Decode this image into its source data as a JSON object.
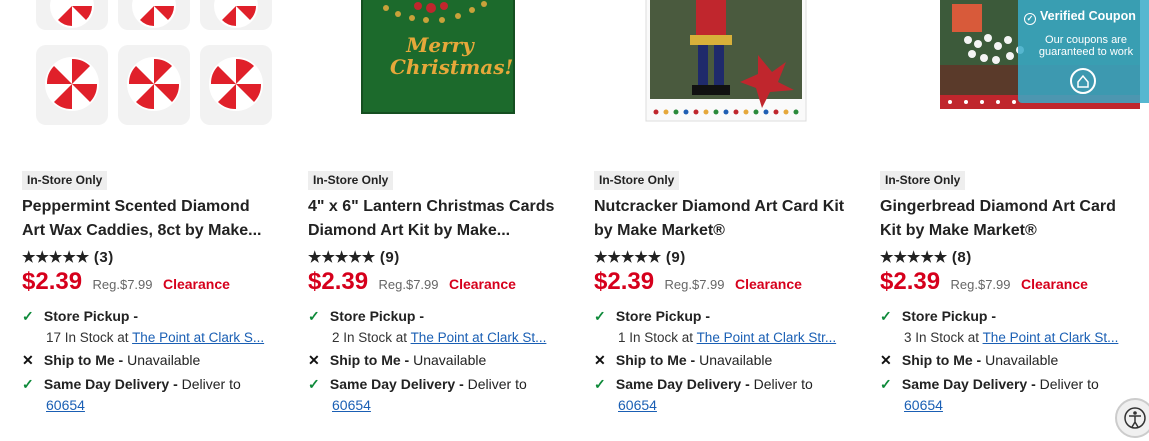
{
  "products": [
    {
      "badge": "In-Store Only",
      "title_line1": "Peppermint Scented Diamond",
      "title_line2": "Art Wax Caddies, 8ct by Make...",
      "stars": "★★★★★",
      "reviews": "(3)",
      "price": "$2.39",
      "reg": "Reg.$7.99",
      "clearance": "Clearance",
      "store_pickup": "Store Pickup -",
      "stock_text": "17 In Stock at ",
      "store_link": "The Point at Clark S...",
      "ship_label": "Ship to Me -",
      "ship_status": "Unavailable",
      "sdd_label": "Same Day Delivery -",
      "sdd_text": "Deliver to",
      "zip": "60654"
    },
    {
      "badge": "In-Store Only",
      "title_line1": "4\" x 6\" Lantern Christmas Cards",
      "title_line2": "Diamond Art Kit by Make...",
      "stars": "★★★★★",
      "reviews": "(9)",
      "price": "$2.39",
      "reg": "Reg.$7.99",
      "clearance": "Clearance",
      "store_pickup": "Store Pickup -",
      "stock_text": "2 In Stock at ",
      "store_link": "The Point at Clark St...",
      "ship_label": "Ship to Me -",
      "ship_status": "Unavailable",
      "sdd_label": "Same Day Delivery -",
      "sdd_text": "Deliver to",
      "zip": "60654",
      "card_text_1": "Merry",
      "card_text_2": "Christmas!"
    },
    {
      "badge": "In-Store Only",
      "title_line1": "Nutcracker Diamond Art Card Kit",
      "title_line2": "by Make Market®",
      "stars": "★★★★★",
      "reviews": "(9)",
      "price": "$2.39",
      "reg": "Reg.$7.99",
      "clearance": "Clearance",
      "store_pickup": "Store Pickup -",
      "stock_text": "1 In Stock at ",
      "store_link": "The Point at Clark Str...",
      "ship_label": "Ship to Me -",
      "ship_status": "Unavailable",
      "sdd_label": "Same Day Delivery -",
      "sdd_text": "Deliver to",
      "zip": "60654"
    },
    {
      "badge": "In-Store Only",
      "title_line1": "Gingerbread Diamond Art Card",
      "title_line2": "Kit by Make Market®",
      "stars": "★★★★★",
      "reviews": "(8)",
      "price": "$2.39",
      "reg": "Reg.$7.99",
      "clearance": "Clearance",
      "store_pickup": "Store Pickup -",
      "stock_text": "3 In Stock at ",
      "store_link": "The Point at Clark St...",
      "ship_label": "Ship to Me -",
      "ship_status": "Unavailable",
      "sdd_label": "Same Day Delivery -",
      "sdd_text": "Deliver to",
      "zip": "60654"
    }
  ],
  "verified_coupon": {
    "title": "Verified Coupon",
    "subtitle": "Our coupons are guaranteed to work"
  },
  "colors": {
    "price_red": "#d6001c",
    "check_green": "#0e8a3a",
    "link_blue": "#1a5fb4"
  },
  "icons": [
    "check-icon",
    "close-x-icon",
    "shield-check-icon",
    "coupon-tag-icon",
    "accessibility-icon"
  ]
}
